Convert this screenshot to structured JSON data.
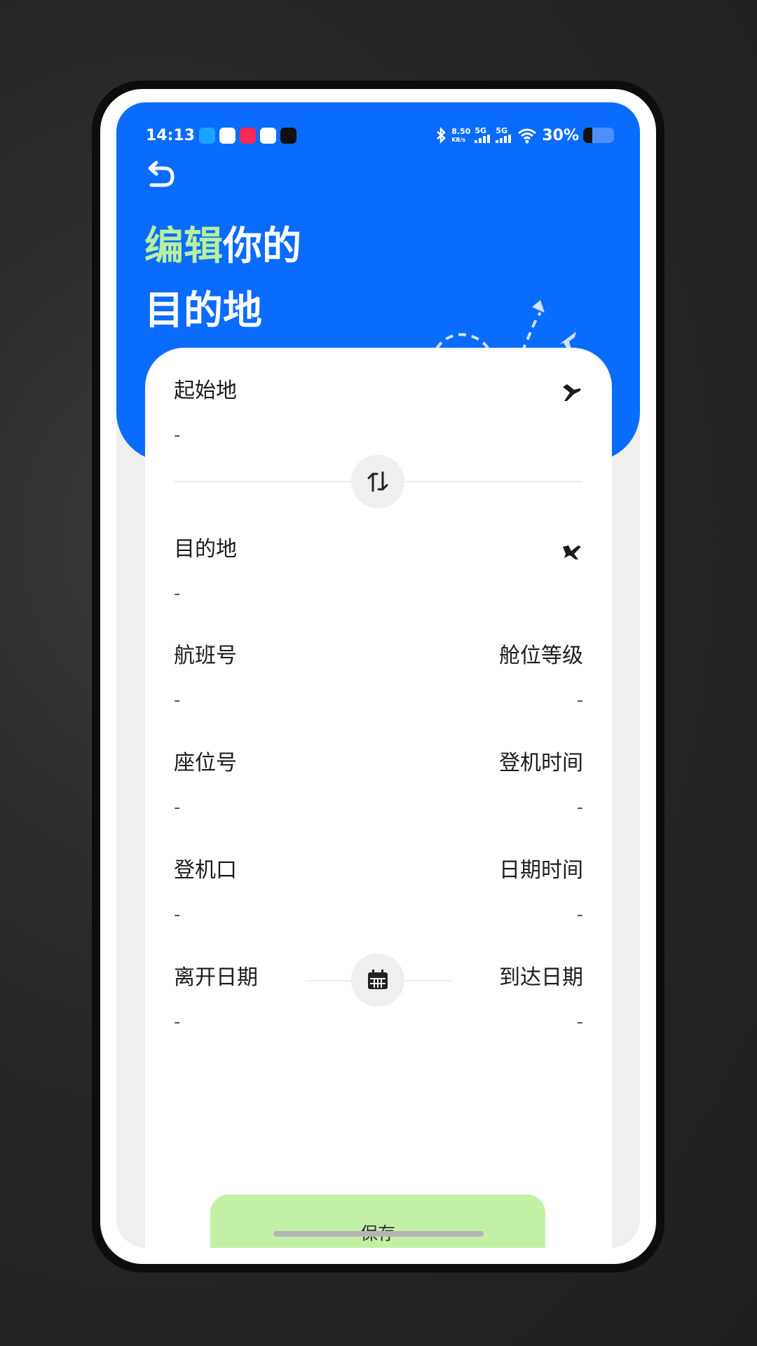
{
  "status_bar": {
    "time": "14:13",
    "net_speed": "8.50",
    "net_unit": "KB/s",
    "sim1": "5G",
    "sim2": "5G",
    "battery": "30%",
    "battery_level": 0.3
  },
  "header": {
    "title_accent": "编辑",
    "title_rest": "你的",
    "title_line2": "目的地"
  },
  "form": {
    "origin": {
      "label": "起始地",
      "value": "-"
    },
    "destination": {
      "label": "目的地",
      "value": "-"
    },
    "flight_number": {
      "label": "航班号",
      "value": "-"
    },
    "cabin_class": {
      "label": "舱位等级",
      "value": "-"
    },
    "seat_number": {
      "label": "座位号",
      "value": "-"
    },
    "boarding_time": {
      "label": "登机时间",
      "value": "-"
    },
    "gate": {
      "label": "登机口",
      "value": "-"
    },
    "date_time": {
      "label": "日期时间",
      "value": "-"
    },
    "departure_date": {
      "label": "离开日期",
      "value": "-"
    },
    "arrival_date": {
      "label": "到达日期",
      "value": "-"
    }
  },
  "actions": {
    "save_label": "保存"
  },
  "colors": {
    "hero_blue": "#0a6cff",
    "accent_green": "#b9ef9e",
    "save_button": "#c2f1a5"
  },
  "icons": {
    "back": "undo-arrow-icon",
    "takeoff": "plane-takeoff-icon",
    "landing": "plane-landing-icon",
    "swap": "swap-icon",
    "calendar": "calendar-icon"
  }
}
